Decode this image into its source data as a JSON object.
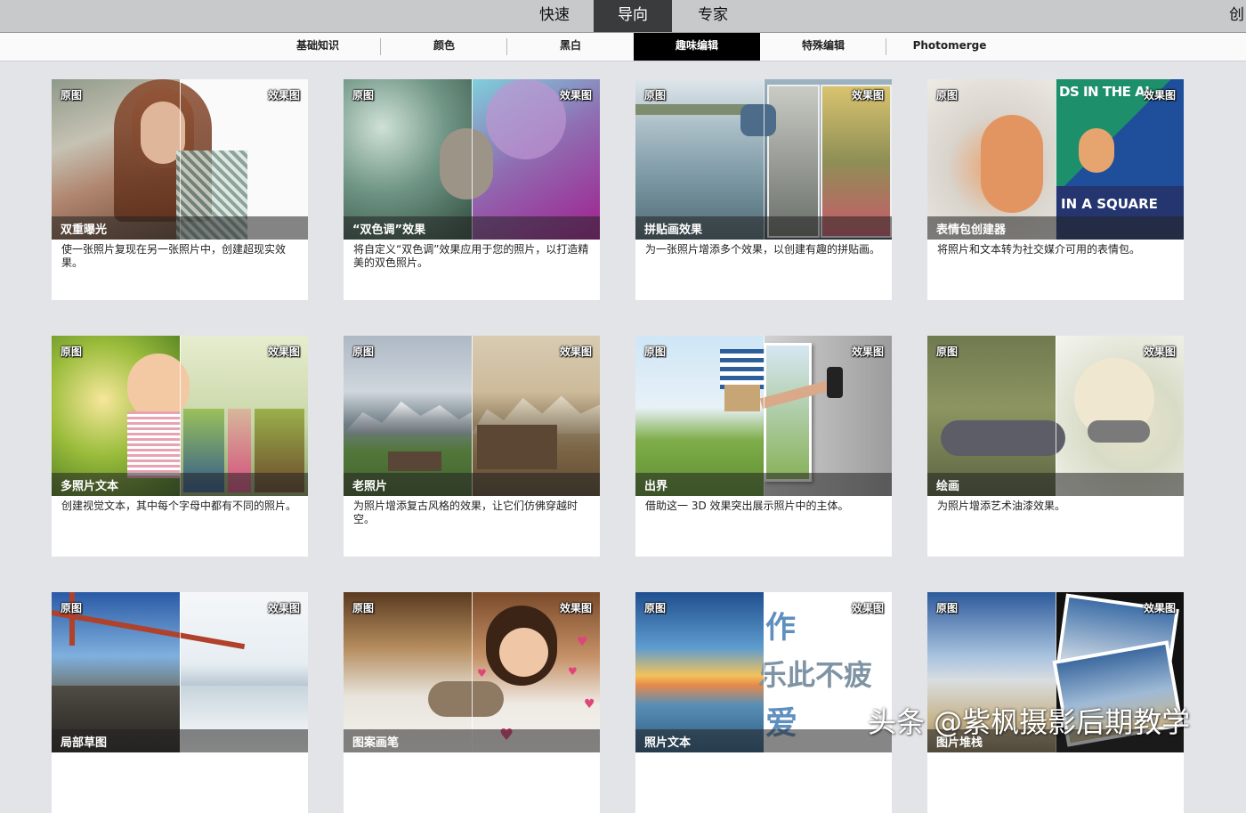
{
  "modes": [
    "快速",
    "导向",
    "专家"
  ],
  "active_mode": "导向",
  "create_label": "创",
  "subtabs": [
    "基础知识",
    "颜色",
    "黑白",
    "趣味编辑",
    "特殊编辑",
    "Photomerge"
  ],
  "active_subtab": "趣味编辑",
  "labels": {
    "before": "原图",
    "after": "效果图"
  },
  "cards": [
    {
      "title": "双重曝光",
      "desc": "使一张照片复现在另一张照片中，创建超现实效果。"
    },
    {
      "title": "“双色调”效果",
      "desc": "将自定义“双色调”效果应用于您的照片，以打造精美的双色照片。"
    },
    {
      "title": "拼贴画效果",
      "desc": "为一张照片增添多个效果，以创建有趣的拼贴画。"
    },
    {
      "title": "表情包创建器",
      "desc": "将照片和文本转为社交媒介可用的表情包。",
      "overlay_top": "DS IN THE AI",
      "overlay_bottom": "IN A SQUARE"
    },
    {
      "title": "多照片文本",
      "desc": "创建视觉文本，其中每个字母中都有不同的照片。"
    },
    {
      "title": "老照片",
      "desc": "为照片增添复古风格的效果，让它们仿佛穿越时空。"
    },
    {
      "title": "出界",
      "desc": "借助这一 3D 效果突出展示照片中的主体。"
    },
    {
      "title": "绘画",
      "desc": "为照片增添艺术油漆效果。"
    },
    {
      "title": "局部草图",
      "desc": ""
    },
    {
      "title": "图案画笔",
      "desc": ""
    },
    {
      "title": "照片文本",
      "desc": "",
      "overlay_lines": [
        "作",
        "乐此不疲",
        "爱"
      ]
    },
    {
      "title": "图片堆栈",
      "desc": ""
    }
  ],
  "watermark": "头条 @紫枫摄影后期教学",
  "colors": {
    "active_tab": "#000000",
    "active_mode": "#3a3b3d",
    "background": "#e3e4e7"
  }
}
